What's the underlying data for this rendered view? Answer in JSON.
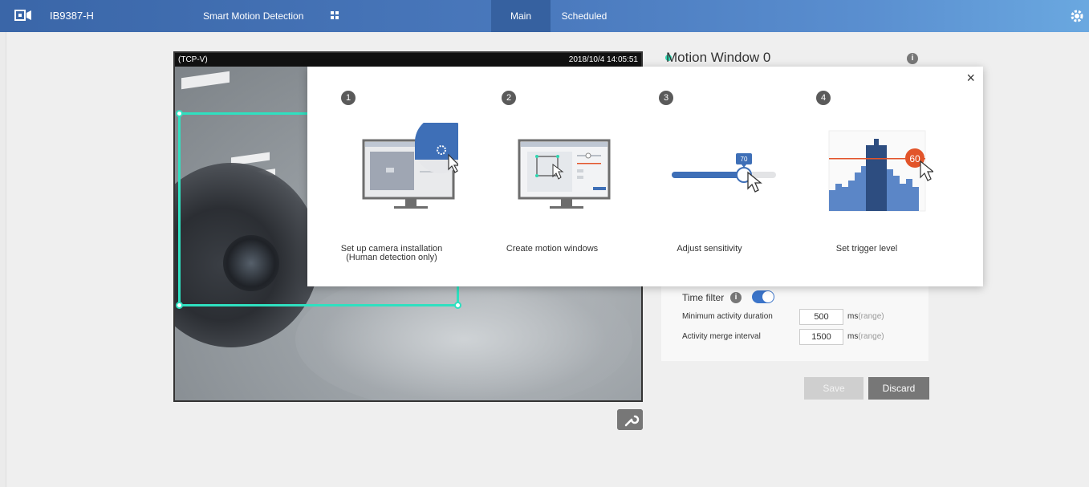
{
  "topbar": {
    "model": "IB9387-H",
    "app_title": "Smart Motion Detection",
    "tabs": [
      {
        "label": "Main"
      },
      {
        "label": "Scheduled"
      }
    ],
    "brand_color": "#3a66a8"
  },
  "video": {
    "stream_label": "(TCP-V)",
    "timestamp": "2018/10/4 14:05:51"
  },
  "panel": {
    "window_title": "Motion Window 0",
    "time_filter_label": "Time filter",
    "rows": [
      {
        "label": "Minimum activity duration",
        "value": "500",
        "unit": "ms",
        "range": "(range)"
      },
      {
        "label": "Activity merge interval",
        "value": "1500",
        "unit": "ms",
        "range": "(range)"
      }
    ],
    "save_label": "Save",
    "discard_label": "Discard"
  },
  "wizard": {
    "close_label": "×",
    "steps": [
      {
        "num": "1",
        "caption_line1": "Set up camera installation",
        "caption_line2": "(Human detection only)"
      },
      {
        "num": "2",
        "caption_line1": "Create motion windows",
        "caption_line2": ""
      },
      {
        "num": "3",
        "caption_line1": "Adjust sensitivity",
        "caption_line2": "",
        "slider_value": "70"
      },
      {
        "num": "4",
        "caption_line1": "Set trigger level",
        "caption_line2": "",
        "trigger_value": "60"
      }
    ]
  }
}
